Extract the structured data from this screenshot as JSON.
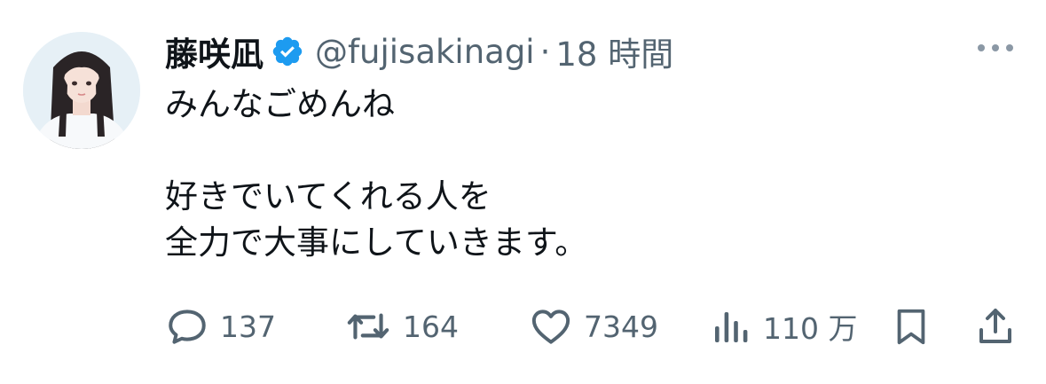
{
  "user": {
    "display_name": "藤咲凪",
    "handle": "@fujisakinagi",
    "separator": "·",
    "time": "18 時間",
    "verified_color": "#1d9bf0"
  },
  "tweet": {
    "lines": [
      "みんなごめんね",
      "",
      "好きでいてくれる人を",
      "全力で大事にしていきます。"
    ]
  },
  "actions": {
    "reply_count": "137",
    "retweet_count": "164",
    "like_count": "7349",
    "view_count": "110 万"
  },
  "icons": {
    "more": "more-icon",
    "reply": "reply-icon",
    "retweet": "retweet-icon",
    "like": "heart-icon",
    "views": "views-icon",
    "bookmark": "bookmark-icon",
    "share": "share-icon"
  },
  "colors": {
    "text": "#0f1419",
    "secondary": "#536471",
    "brand": "#1d9bf0"
  }
}
